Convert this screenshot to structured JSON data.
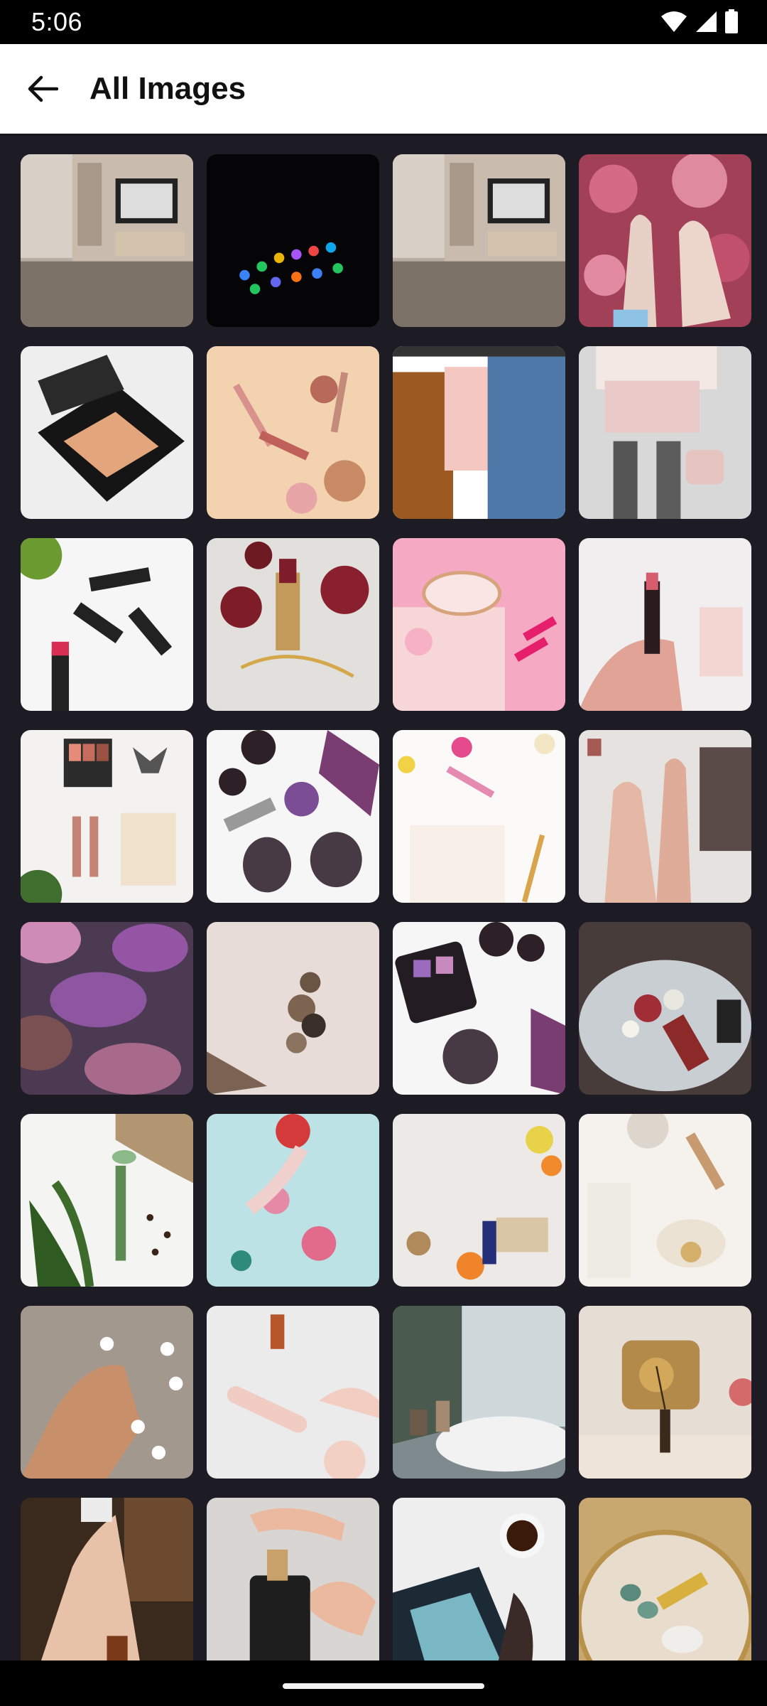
{
  "status_bar": {
    "time": "5:06",
    "icons": [
      "wifi-icon",
      "signal-icon",
      "battery-icon"
    ]
  },
  "app_bar": {
    "title": "All Images",
    "back_icon": "arrow-back-icon"
  },
  "images": [
    "living-room-tv",
    "phone-dark-screen",
    "living-room-tv",
    "hands-with-rings-flowers",
    "compact-powder",
    "makeup-brushes-peach",
    "clothes-on-rack",
    "pink-skirt-handbag",
    "red-lipsticks",
    "lipstick-dried-roses",
    "pink-mirror-lipstick",
    "hand-holding-lipstick",
    "eyeshadow-palette-brushes",
    "figs-blackberries-lipstick",
    "notebook-flowers-pen",
    "hand-nails-palette",
    "purple-eyeshadow-closeup",
    "pink-marble-pebbles",
    "palette-figs-berries",
    "mirror-flowers-lipgloss",
    "jade-roller-coffee-beans",
    "pool-flowers-hand",
    "citrus-ginger-soap",
    "towel-brush-soap",
    "hand-daisies",
    "rose-quartz-roller",
    "bathtub-window",
    "gold-pillow-diffuser",
    "serum-dropper-arm",
    "soap-dispenser-hands",
    "magazines-tea",
    "gold-tray-roller"
  ],
  "colors": {
    "background": "#1d1c24",
    "app_bar": "#ffffff",
    "status_bar": "#000000"
  }
}
